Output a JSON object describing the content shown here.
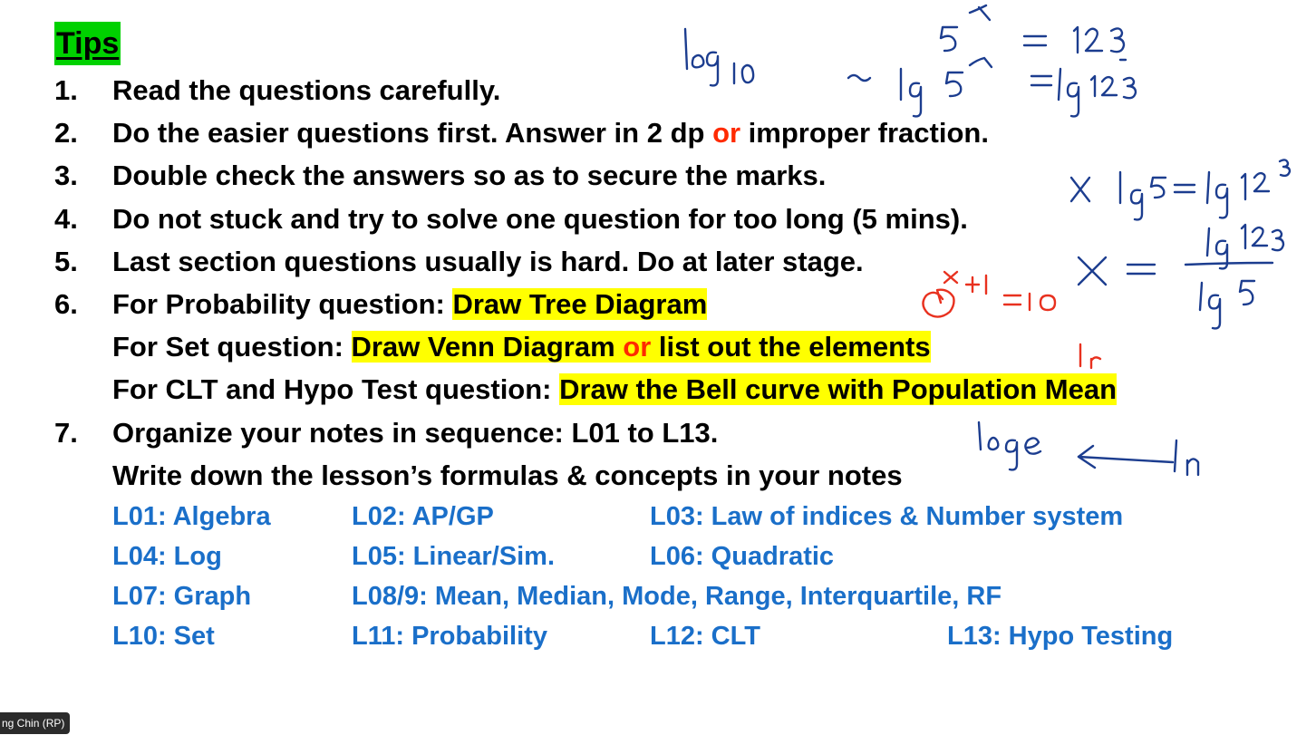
{
  "title": "Tips",
  "tips": [
    {
      "num": "1.",
      "text": "Read the questions carefully."
    },
    {
      "num": "2.",
      "pre": "Do the easier questions first. Answer in 2 dp ",
      "red": "or",
      "post": " improper fraction."
    },
    {
      "num": "3.",
      "text": "Double check the answers so as to secure the marks."
    },
    {
      "num": "4.",
      "text": "Do not stuck and try to solve one question for too long (5 mins)."
    },
    {
      "num": "5.",
      "text": "Last section questions usually is hard. Do at later stage."
    },
    {
      "num": "6.",
      "pre": "For Probability question: ",
      "hl": "Draw Tree Diagram"
    },
    {
      "num": "7.",
      "text": "Organize your notes in sequence: L01 to L13."
    }
  ],
  "set_line": {
    "pre": "For Set question: ",
    "hl1": "Draw Venn Diagram ",
    "red": "or",
    "hl2": " list out the elements"
  },
  "clt_line": {
    "pre": "For CLT and Hypo Test question: ",
    "hl": "Draw the Bell curve with Population Mean"
  },
  "notes_line": "Write down the lesson’s formulas & concepts in your notes",
  "lessons": [
    [
      "L01: Algebra",
      "L02: AP/GP",
      "L03: Law of indices & Number system",
      ""
    ],
    [
      "L04: Log",
      "L05: Linear/Sim.",
      "L06: Quadratic",
      ""
    ],
    [
      "L07: Graph",
      "L08/9: Mean, Median, Mode, Range, Interquartile, RF",
      "",
      ""
    ],
    [
      "L10: Set",
      "L11: Probability",
      "L12: CLT",
      "L13: Hypo Testing"
    ]
  ],
  "participant_name": "ng Chin (RP)",
  "colors": {
    "title_bg": "#00d100",
    "highlight": "#ffff00",
    "emphasis_red": "#ff2a00",
    "lesson_blue": "#1a6fc9",
    "ink_blue": "#1c3d8f",
    "ink_red": "#e8311f"
  }
}
